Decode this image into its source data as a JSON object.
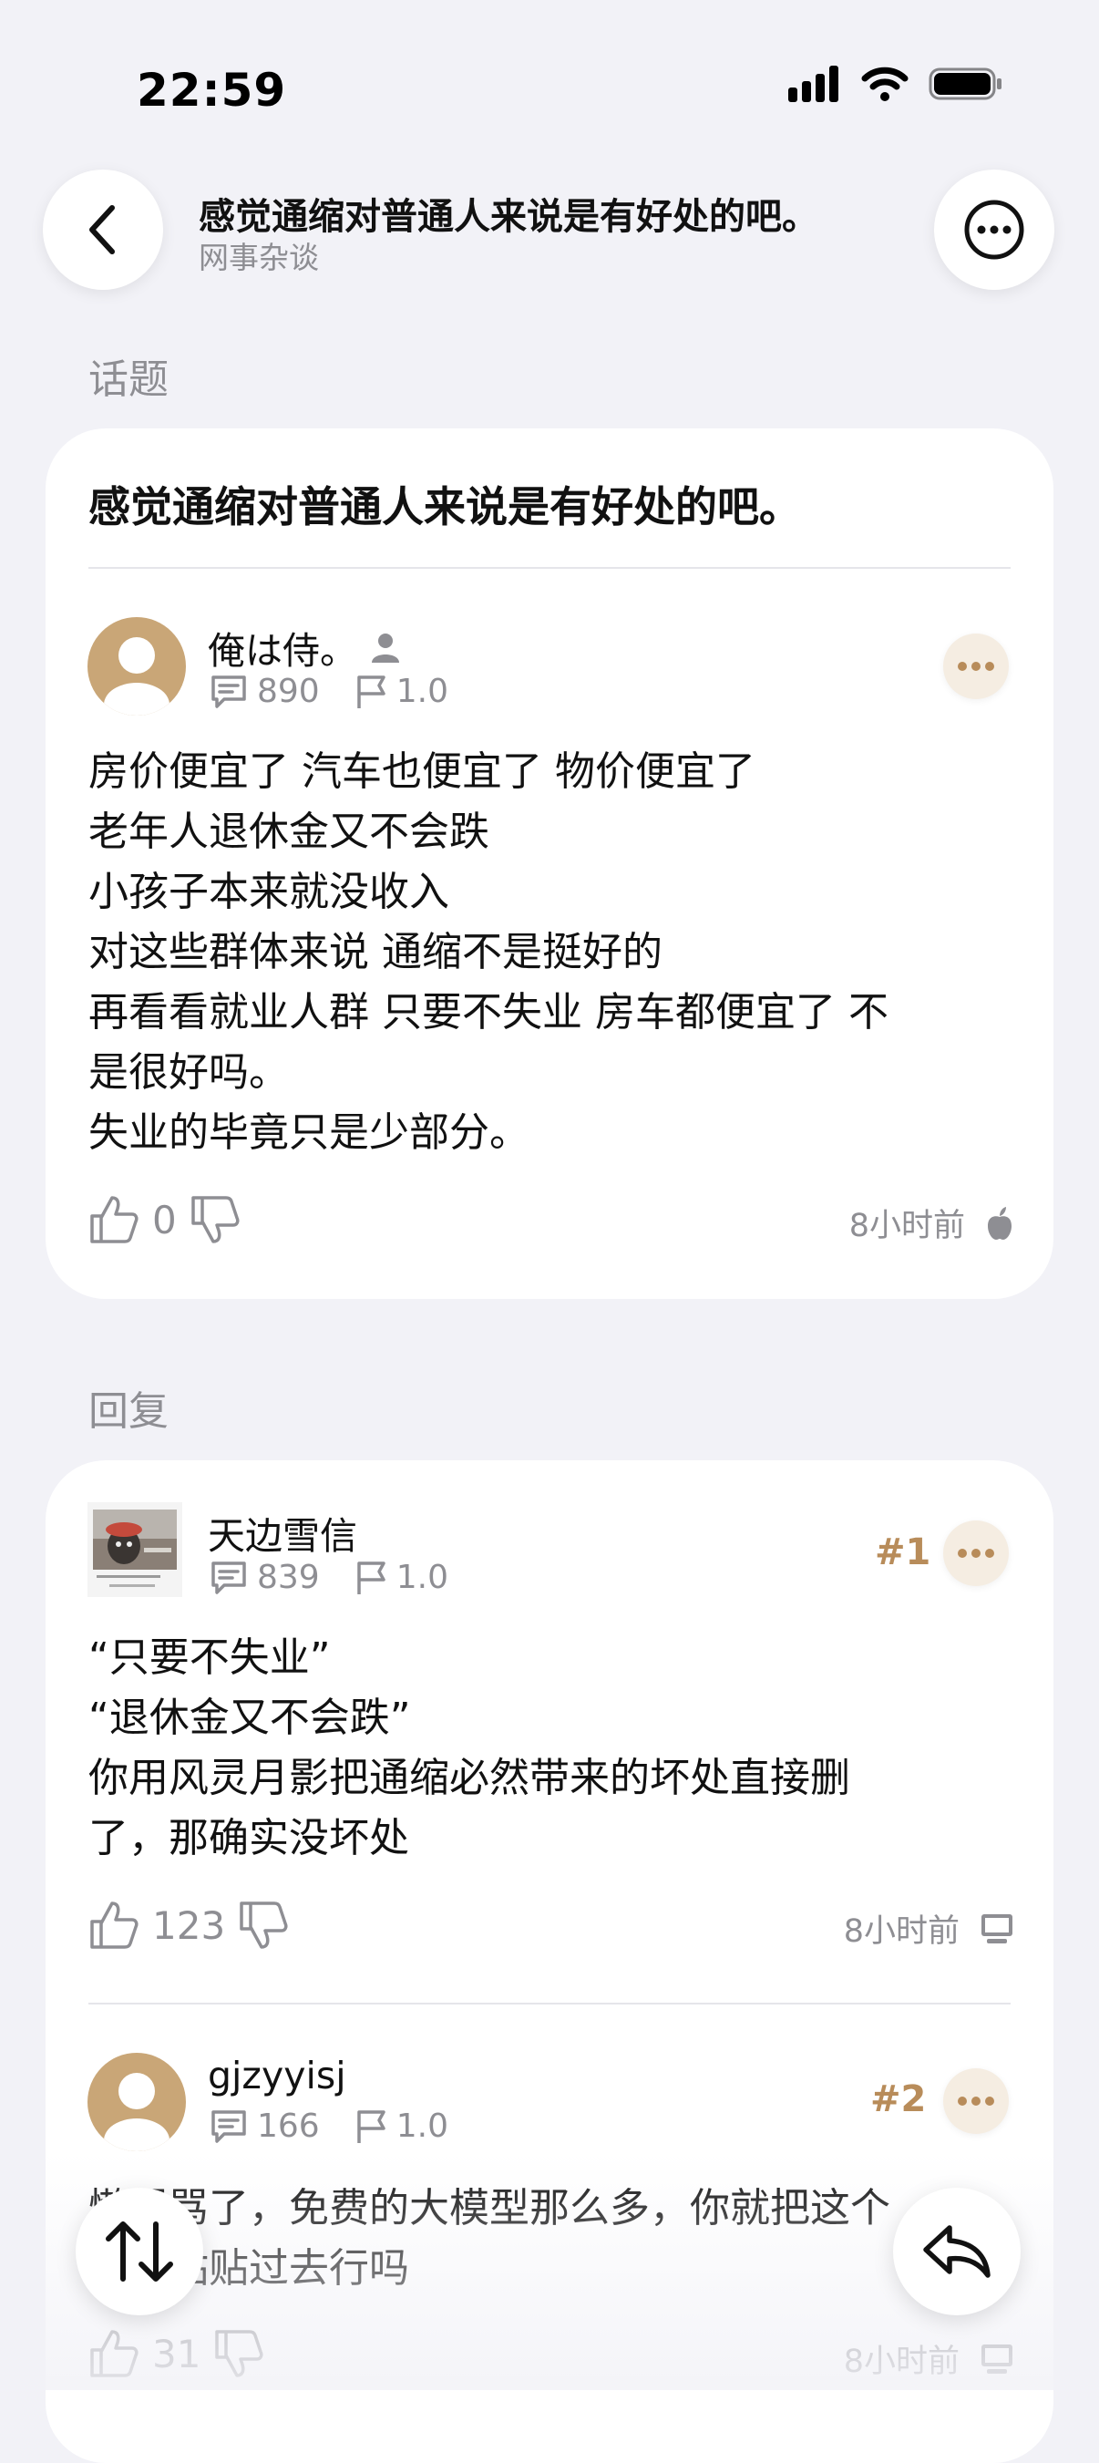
{
  "status_bar": {
    "time": "22:59"
  },
  "header": {
    "title": "感觉通缩对普通人来说是有好处的吧。",
    "subtitle": "网事杂谈"
  },
  "topic_section_label": "话题",
  "topic": {
    "title": "感觉通缩对普通人来说是有好处的吧。",
    "author": {
      "name": "俺は侍。",
      "comment_count": "890",
      "level": "1.0"
    },
    "body_lines": [
      "房价便宜了 汽车也便宜了  物价便宜了",
      "老年人退休金又不会跌",
      "小孩子本来就没收入",
      "对这些群体来说 通缩不是挺好的",
      "再看看就业人群 只要不失业 房车都便宜了 不",
      "是很好吗。",
      "失业的毕竟只是少部分。"
    ],
    "likes": "0",
    "time": "8小时前",
    "device_icon": "apple-icon"
  },
  "replies_section_label": "回复",
  "replies": [
    {
      "floor": "#1",
      "author": "天边雪信",
      "comment_count": "839",
      "level": "1.0",
      "body_lines": [
        "“只要不失业”",
        "“退休金又不会跌”",
        "你用风灵月影把通缩必然带来的坏处直接删",
        "了，那确实没坏处"
      ],
      "likes": "123",
      "time": "8小时前",
      "device_icon": "desktop-icon"
    },
    {
      "floor": "#2",
      "author": "gjzyyisj",
      "comment_count": "166",
      "level": "1.0",
      "body_lines": [
        "懒得骂了，免费的大模型那么多，你就把这个",
        "问题粘贴过去行吗"
      ],
      "likes": "31",
      "time": "8小时前",
      "device_icon": "desktop-icon"
    }
  ],
  "colors": {
    "background": "#f2f2f7",
    "accent": "#b88c5a",
    "avatar_default": "#c9a677"
  }
}
